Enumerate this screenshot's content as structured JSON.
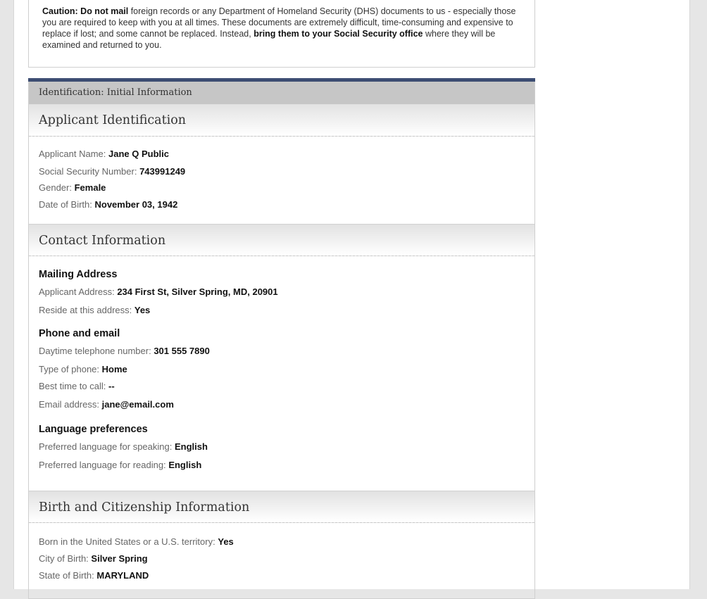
{
  "caution": {
    "label": "Caution:",
    "bold1": "Do not mail",
    "text1": " foreign records or any Department of Homeland Security (DHS) documents to us - especially those you are required to keep with you at all times. These documents are extremely difficult, time-consuming and expensive to replace if lost; and some cannot be replaced. Instead, ",
    "bold2": "bring them to your Social Security office",
    "text2": " where they will be examined and returned to you."
  },
  "id_bar": "Identification: Initial Information",
  "applicant": {
    "heading": "Applicant Identification",
    "name_label": "Applicant Name:",
    "name_value": "Jane Q Public",
    "ssn_label": "Social Security Number:",
    "ssn_value": "743991249",
    "gender_label": "Gender:",
    "gender_value": "Female",
    "dob_label": "Date of Birth:",
    "dob_value": "November 03, 1942"
  },
  "contact": {
    "heading": "Contact Information",
    "mailing_heading": "Mailing Address",
    "address_label": "Applicant Address:",
    "address_value": "234 First St, Silver Spring, MD, 20901",
    "reside_label": "Reside at this address:",
    "reside_value": "Yes",
    "phone_heading": "Phone and email",
    "daytime_label": "Daytime telephone number:",
    "daytime_value": "301 555 7890",
    "phone_type_label": "Type of phone:",
    "phone_type_value": "Home",
    "best_time_label": "Best time to call:",
    "best_time_value": "--",
    "email_label": "Email address:",
    "email_value": "jane@email.com",
    "language_heading": "Language preferences",
    "speaking_label": "Preferred language for speaking:",
    "speaking_value": "English",
    "reading_label": "Preferred language for reading:",
    "reading_value": "English"
  },
  "birth": {
    "heading": "Birth and Citizenship Information",
    "born_us_label": "Born in the United States or a U.S. territory:",
    "born_us_value": "Yes",
    "city_label": "City of Birth:",
    "city_value": "Silver Spring",
    "state_label": "State of Birth:",
    "state_value": "MARYLAND"
  }
}
